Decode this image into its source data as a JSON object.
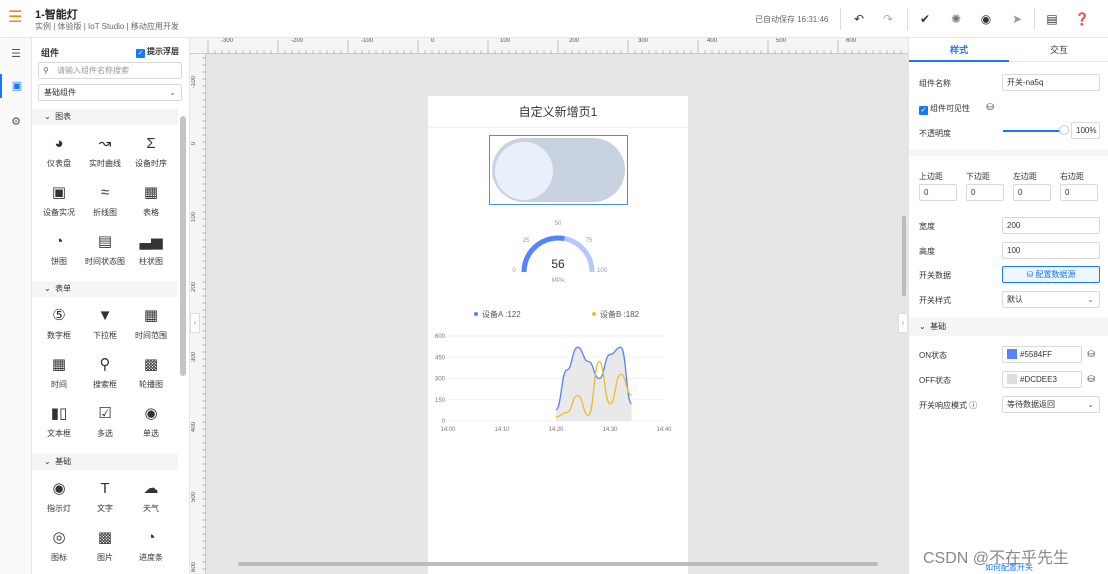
{
  "header": {
    "project_title": "1-智能灯",
    "project_sub": "实例 | 体验版 | IoT Studio | 移动应用开发",
    "autosave": "已自动保存 16:31:46"
  },
  "components": {
    "title": "组件",
    "float_label": "提示浮层",
    "search_placeholder": "请输入组件名称搜索",
    "category": "基础组件",
    "groups": [
      {
        "label": "图表",
        "items": [
          "仪表盘",
          "实时曲线",
          "设备时序",
          "设备实况",
          "折线图",
          "表格",
          "饼图",
          "时间状态图",
          "柱状图"
        ]
      },
      {
        "label": "表单",
        "items": [
          "数字框",
          "下拉框",
          "时间范围",
          "时间",
          "搜索框",
          "轮播图",
          "文本框",
          "多选",
          "单选"
        ]
      },
      {
        "label": "基础",
        "items": [
          "指示灯",
          "文字",
          "天气",
          "图标",
          "图片",
          "进度条"
        ]
      }
    ]
  },
  "ruler": {
    "top": [
      "-300",
      "-200",
      "-100",
      "0",
      "100",
      "200",
      "300",
      "400",
      "500",
      "600"
    ],
    "left": [
      "-100",
      "0",
      "100",
      "200",
      "300",
      "400",
      "500",
      "600"
    ]
  },
  "page": {
    "title": "自定义新增页1"
  },
  "gauge": {
    "value": "56",
    "unit": "MPA",
    "value_num": 56,
    "max": 100,
    "ticks": [
      "0",
      "25",
      "50",
      "75",
      "100"
    ],
    "color_on": "#5584FF",
    "color_off": "#B6C7F9"
  },
  "chart_data": {
    "type": "line",
    "x": [
      "14:00",
      "14:10",
      "14:20",
      "14:30",
      "14:40"
    ],
    "yticks": [
      "0",
      "150",
      "300",
      "450",
      "600"
    ],
    "ylim": [
      0,
      600
    ],
    "legend": "top",
    "series": [
      {
        "name": "设备A",
        "legend_value": "122",
        "color": "#5584FF",
        "points": [
          [
            20,
            80
          ],
          [
            22,
            360
          ],
          [
            24,
            520
          ],
          [
            26,
            420
          ],
          [
            28,
            300
          ],
          [
            30,
            470
          ],
          [
            32,
            520
          ],
          [
            34,
            122
          ]
        ]
      },
      {
        "name": "设备B",
        "legend_value": "182",
        "color": "#F2B92A",
        "points": [
          [
            20,
            30
          ],
          [
            22,
            60
          ],
          [
            24,
            180
          ],
          [
            26,
            40
          ],
          [
            28,
            420
          ],
          [
            30,
            120
          ],
          [
            32,
            330
          ],
          [
            34,
            182
          ]
        ]
      }
    ],
    "legend_texts": {
      "a": "设备A :122",
      "b": "设备B :182"
    }
  },
  "props": {
    "tabs": [
      "样式",
      "交互"
    ],
    "comp_name_label": "组件名称",
    "comp_name_value": "开关-na5q",
    "visible_label": "组件可见性",
    "opacity_label": "不透明度",
    "opacity_value": "100%",
    "opacity_fraction": 1.0,
    "margin_labels": [
      "上边距",
      "下边距",
      "左边距",
      "右边距"
    ],
    "margin_values": [
      "0",
      "0",
      "0",
      "0"
    ],
    "width_label": "宽度",
    "width_value": "200",
    "height_label": "高度",
    "height_value": "100",
    "switch_data_label": "开关数据",
    "datasource_btn": "配置数据源",
    "switch_style_label": "开关样式",
    "switch_style_value": "默认",
    "basic_section": "基础",
    "on_label": "ON状态",
    "on_color": "#5584FF",
    "off_label": "OFF状态",
    "off_color": "#DCDEE3",
    "resp_label": "开关响应模式",
    "resp_value": "等待数据返回",
    "help_link": "如何配置开关",
    "watermark": "CSDN @不在乎先生"
  }
}
